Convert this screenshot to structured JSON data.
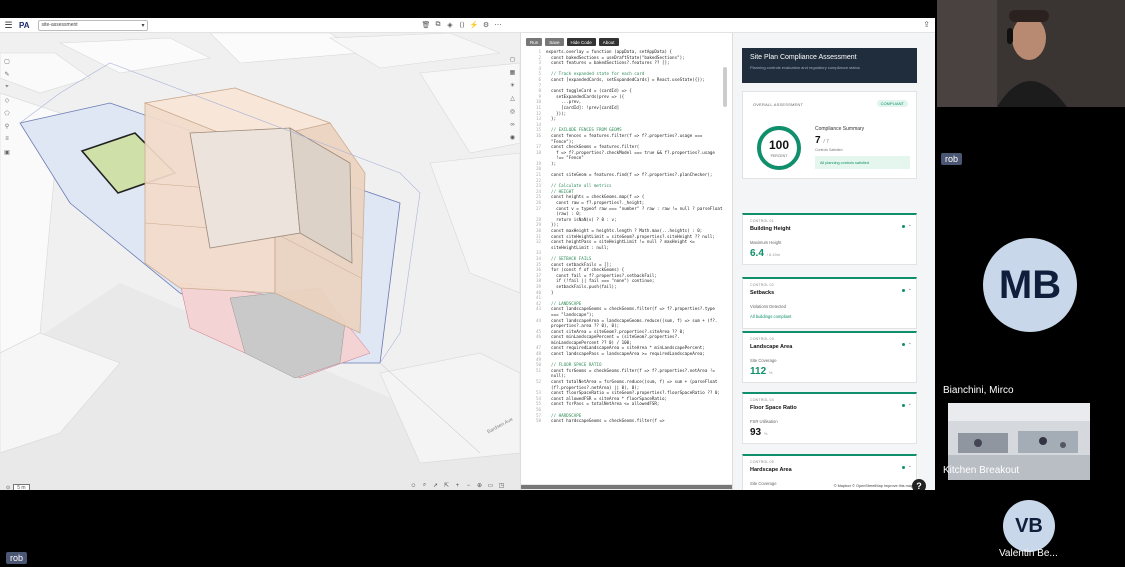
{
  "topbar": {
    "project_name": "site-assessment",
    "logo": "PA"
  },
  "map": {
    "street_label": "Bardsen Ave",
    "scale_label": "5 m"
  },
  "code_editor": {
    "buttons": [
      "Run",
      "Save",
      "Hide Code",
      "About"
    ],
    "tooltip": "Esc",
    "lines": [
      {
        "n": "1",
        "t": "exports.overlay = function (appData, setAppData) {"
      },
      {
        "n": "2",
        "t": "  const bakedSections = useDraftState(\"bakedSections\");"
      },
      {
        "n": "3",
        "t": "  const features = bakedSections?.features ?? [];"
      },
      {
        "n": "4",
        "t": ""
      },
      {
        "n": "5",
        "t": "  // Track expanded state for each card",
        "c": true
      },
      {
        "n": "6",
        "t": "  const [expandedCards, setExpandedCards] = React.useState({});"
      },
      {
        "n": "7",
        "t": ""
      },
      {
        "n": "8",
        "t": "  const toggleCard = (cardId) => {"
      },
      {
        "n": "9",
        "t": "    setExpandedCards(prev => ({"
      },
      {
        "n": "10",
        "t": "      ...prev,"
      },
      {
        "n": "11",
        "t": "      [cardId]: !prev[cardId]"
      },
      {
        "n": "12",
        "t": "    }));"
      },
      {
        "n": "13",
        "t": "  };"
      },
      {
        "n": "14",
        "t": ""
      },
      {
        "n": "15",
        "t": "  // EXCLUDE FENCES FROM GEOMS",
        "c": true
      },
      {
        "n": "16",
        "t": "  const fences = features.filter(f => f?.properties?.usage ==="
      },
      {
        "n": "",
        "t": "  \"Fence\");"
      },
      {
        "n": "17",
        "t": "  const checkGeoms = features.filter("
      },
      {
        "n": "18",
        "t": "    f => f?.properties?.checkModel === true && f?.properties?.usage"
      },
      {
        "n": "",
        "t": "    !== \"Fence\""
      },
      {
        "n": "19",
        "t": "  );"
      },
      {
        "n": "20",
        "t": ""
      },
      {
        "n": "21",
        "t": "  const siteGeom = features.find(f => f?.properties?.planChecker);"
      },
      {
        "n": "22",
        "t": ""
      },
      {
        "n": "23",
        "t": "  // Calculate all metrics",
        "c": true
      },
      {
        "n": "24",
        "t": "  // HEIGHT",
        "c": true
      },
      {
        "n": "25",
        "t": "  const heights = checkGeoms.map(f => {"
      },
      {
        "n": "26",
        "t": "    const raw = f?.properties?._height;"
      },
      {
        "n": "27",
        "t": "    const v = typeof raw === \"number\" ? raw : raw != null ? parseFloat"
      },
      {
        "n": "",
        "t": "    (raw) : 0;"
      },
      {
        "n": "28",
        "t": "    return isNaN(v) ? 0 : v;"
      },
      {
        "n": "29",
        "t": "  });"
      },
      {
        "n": "30",
        "t": "  const maxHeight = heights.length ? Math.max(...heights) : 0;"
      },
      {
        "n": "31",
        "t": "  const siteHeightLimit = siteGeom?.properties?.siteHeight ?? null;"
      },
      {
        "n": "32",
        "t": "  const heightPass = siteHeightLimit != null ? maxHeight <="
      },
      {
        "n": "",
        "t": "  siteHeightLimit : null;"
      },
      {
        "n": "33",
        "t": ""
      },
      {
        "n": "34",
        "t": "  // SETBACK FAILS",
        "c": true
      },
      {
        "n": "35",
        "t": "  const setbackFails = [];"
      },
      {
        "n": "36",
        "t": "  for (const f of checkGeoms) {"
      },
      {
        "n": "37",
        "t": "    const fail = f?.properties?.setbackFail;"
      },
      {
        "n": "38",
        "t": "    if (!fail || fail === \"none\") continue;"
      },
      {
        "n": "39",
        "t": "    setbackFails.push(fail);"
      },
      {
        "n": "40",
        "t": "  }"
      },
      {
        "n": "41",
        "t": ""
      },
      {
        "n": "42",
        "t": "  // LANDSCAPE",
        "c": true
      },
      {
        "n": "43",
        "t": "  const landscapeGeoms = checkGeoms.filter(f => f?.properties?.type"
      },
      {
        "n": "",
        "t": "  === \"landscape\");"
      },
      {
        "n": "44",
        "t": "  const landscapeArea = landscapeGeoms.reduce((sum, f) => sum + (f?."
      },
      {
        "n": "",
        "t": "  properties?.area ?? 0), 0);"
      },
      {
        "n": "45",
        "t": "  const siteArea = siteGeom?.properties?.siteArea ?? 0;"
      },
      {
        "n": "46",
        "t": "  const minLandscapePercent = (siteGeom?.properties?."
      },
      {
        "n": "",
        "t": "  minLandscapePercent ?? 0) / 100;"
      },
      {
        "n": "47",
        "t": "  const requiredLandscapeArea = siteArea * minLandscapePercent;"
      },
      {
        "n": "48",
        "t": "  const landscapePass = landscapeArea >= requiredLandscapeArea;"
      },
      {
        "n": "49",
        "t": ""
      },
      {
        "n": "50",
        "t": "  // FLOOR SPACE RATIO",
        "c": true
      },
      {
        "n": "51",
        "t": "  const fsrGeoms = checkGeoms.filter(f => f?.properties?.netArea !="
      },
      {
        "n": "",
        "t": "  null);"
      },
      {
        "n": "52",
        "t": "  const totalNetArea = fsrGeoms.reduce((sum, f) => sum + (parseFloat"
      },
      {
        "n": "",
        "t": "  (f?.properties?.netArea) || 0), 0);"
      },
      {
        "n": "53",
        "t": "  const floorSpaceRatio = siteGeom?.properties?.floorSpaceRatio ?? 0;"
      },
      {
        "n": "54",
        "t": "  const allowedFSR = siteArea * floorSpaceRatio;"
      },
      {
        "n": "55",
        "t": "  const fsrPass = totalNetArea <= allowedFSR;"
      },
      {
        "n": "56",
        "t": ""
      },
      {
        "n": "57",
        "t": "  // HARDSCAPE",
        "c": true
      },
      {
        "n": "58",
        "t": "  const hardscapeGeoms = checkGeoms.filter(f =>"
      }
    ]
  },
  "panel": {
    "title": "Site Plan Compliance Assessment",
    "subtitle": "Planning controls evaluation and regulatory compliance status",
    "overall_label": "OVERALL ASSESSMENT",
    "overall_status": "COMPLIANT",
    "score": "100",
    "score_label": "PERCENT",
    "score_fraction": 1.0,
    "summary_title": "Compliance Summary",
    "summary_value": "7",
    "summary_of": "/ 7",
    "summary_sub": "Controls Satisfied",
    "summary_ok": "All planning controls satisfied",
    "controls": [
      {
        "label": "CONTROL 01",
        "title": "Building Height",
        "metric": "Maximum Height",
        "value": "6.4",
        "unit": "/ 8.15m"
      },
      {
        "label": "CONTROL 02",
        "title": "Setbacks",
        "metric": "Violations Detected",
        "note": "All buildings compliant"
      },
      {
        "label": "CONTROL 03",
        "title": "Landscape Area",
        "metric": "Site Coverage",
        "value": "112",
        "unit": "%"
      },
      {
        "label": "CONTROL 04",
        "title": "Floor Space Ratio",
        "metric": "FSR Utilisation",
        "value": "93",
        "unit": "%"
      },
      {
        "label": "CONTROL 05",
        "title": "Hardscape Area",
        "metric": "Site Coverage"
      }
    ],
    "attribution": "© Mapbox © OpenStreetMap Improve this map"
  },
  "participants": {
    "rob_tag": "rob",
    "rob_bottom_tag": "rob",
    "mb_initials": "MB",
    "mb_name": "Bianchini, Mirco",
    "kitchen_name": "Kitchen Breakout",
    "vb_initials": "VB",
    "vb_name": "Valentin Be..."
  },
  "colors": {
    "accent_green": "#0f8f6b",
    "header_dark": "#1f2d3d",
    "avatar_bg": "#c8d7e9",
    "name_tag_bg": "#4b5673"
  }
}
